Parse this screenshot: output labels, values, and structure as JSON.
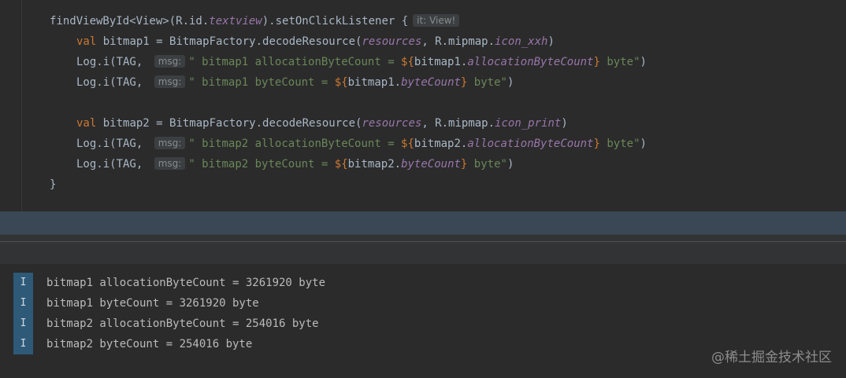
{
  "editor": {
    "line1": {
      "call": "findViewById<View>(R.id.",
      "textview": "textview",
      "rest": ").setOnClickListener {",
      "hint": "it: View!"
    },
    "line2": {
      "kw": "val",
      "mid": " bitmap1 = BitmapFactory.decodeResource(",
      "resources": "resources",
      "comma": ", R.mipmap.",
      "icon": "icon_xxh",
      "close": ")"
    },
    "line3": {
      "pre": "Log.i(TAG, ",
      "hint": "msg:",
      "str1": "\" bitmap1 allocationByteCount = ",
      "t_open": "${",
      "var": "bitmap1.",
      "prop": "allocationByteCount",
      "t_close": "}",
      "str2": " byte\"",
      "close": ")"
    },
    "line4": {
      "pre": "Log.i(TAG, ",
      "hint": "msg:",
      "str1": "\" bitmap1 byteCount = ",
      "t_open": "${",
      "var": "bitmap1.",
      "prop": "byteCount",
      "t_close": "}",
      "str2": " byte\"",
      "close": ")"
    },
    "line5": {
      "kw": "val",
      "mid": " bitmap2 = BitmapFactory.decodeResource(",
      "resources": "resources",
      "comma": ", R.mipmap.",
      "icon": "icon_print",
      "close": ")"
    },
    "line6": {
      "pre": "Log.i(TAG, ",
      "hint": "msg:",
      "str1": "\" bitmap2 allocationByteCount = ",
      "t_open": "${",
      "var": "bitmap2.",
      "prop": "allocationByteCount",
      "t_close": "}",
      "str2": " byte\"",
      "close": ")"
    },
    "line7": {
      "pre": "Log.i(TAG, ",
      "hint": "msg:",
      "str1": "\" bitmap2 byteCount = ",
      "t_open": "${",
      "var": "bitmap2.",
      "prop": "byteCount",
      "t_close": "}",
      "str2": " byte\"",
      "close": ")"
    },
    "line8": {
      "brace": "}"
    }
  },
  "logcat": {
    "rows": [
      {
        "level": "I",
        "text": "bitmap1 allocationByteCount = 3261920 byte"
      },
      {
        "level": "I",
        "text": "bitmap1 byteCount = 3261920 byte"
      },
      {
        "level": "I",
        "text": "bitmap2 allocationByteCount = 254016 byte"
      },
      {
        "level": "I",
        "text": "bitmap2 byteCount = 254016 byte"
      }
    ]
  },
  "watermark": "@稀土掘金技术社区",
  "colors": {
    "editor_bg": "#2b2b2b",
    "keyword": "#cc7832",
    "string": "#6a8759",
    "param": "#9876aa",
    "level_badge": "#2e5a78",
    "divider_band": "#3a4754"
  }
}
